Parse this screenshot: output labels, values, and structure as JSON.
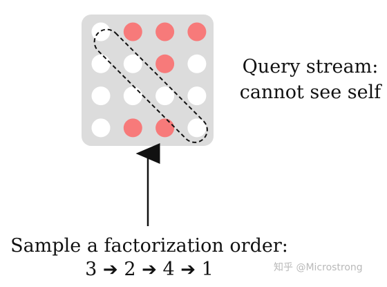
{
  "colors": {
    "matrix_background": "#dcdcdc",
    "masked_cell": "#f77a7a",
    "visible_cell": "#ffffff",
    "outline": "#111111",
    "watermark": "#b9b9b9"
  },
  "matrix": {
    "rows": 4,
    "cols": 4,
    "cells": [
      [
        "visible",
        "masked",
        "masked",
        "masked"
      ],
      [
        "visible",
        "visible",
        "masked",
        "visible"
      ],
      [
        "visible",
        "visible",
        "visible",
        "visible"
      ],
      [
        "visible",
        "masked",
        "masked",
        "visible"
      ]
    ],
    "diagonal_highlight": "dashed"
  },
  "query_label": {
    "line1": "Query stream:",
    "line2": "cannot see self"
  },
  "sample_label": {
    "line1": "Sample a factorization order:",
    "order": [
      "3",
      "2",
      "4",
      "1"
    ],
    "arrow_glyph": "➔"
  },
  "watermark": {
    "text": "知乎 @Microstrong"
  }
}
